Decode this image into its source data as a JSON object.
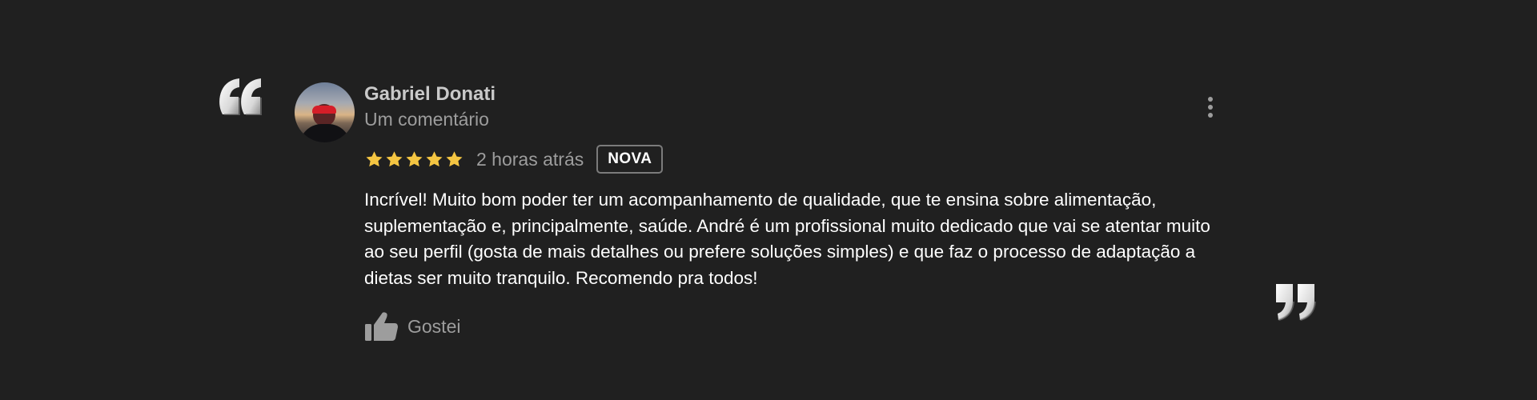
{
  "review": {
    "author": {
      "name": "Gabriel Donati",
      "meta": "Um comentário"
    },
    "rating": {
      "value": 5,
      "max": 5,
      "color": "#f4c542"
    },
    "time_ago": "2 horas atrás",
    "badge": "NOVA",
    "text": "Incrível! Muito bom poder ter um acompanhamento de qualidade, que te ensina sobre alimentação, suplementação e, principalmente, saúde. André é um profissional muito dedicado que vai se atentar muito ao seu perfil (gosta de mais detalhes ou prefere soluções simples) e que faz o processo de adaptação a dietas ser muito tranquilo. Recomendo pra todos!",
    "actions": {
      "like_label": "Gostei"
    }
  },
  "icons": {
    "quote_open": "quote-open-icon",
    "quote_close": "quote-close-icon",
    "menu": "more-vertical-icon",
    "star": "star-icon",
    "like": "thumbs-up-icon"
  },
  "colors": {
    "background": "#202020",
    "primary_text": "#ffffff",
    "secondary_text": "#9d9d9d",
    "name_text": "#c9c9c9",
    "badge_border": "#7b7b7b",
    "quote": "#f0f0f0"
  }
}
